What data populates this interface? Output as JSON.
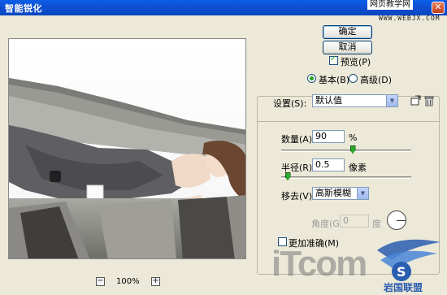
{
  "window": {
    "title": "智能锐化",
    "close_glyph": "✕"
  },
  "watermarks": {
    "site_name": "网页教学网",
    "site_url": "WWW.WEBJX.COM",
    "itcom_logo": "iTcom",
    "badge_text": "岩国联盟"
  },
  "buttons": {
    "ok": "确定",
    "cancel": "取消"
  },
  "preview_toggle": {
    "label": "预览(P)",
    "checked": true
  },
  "mode": {
    "basic": "基本(B)",
    "advanced": "高级(D)",
    "selected": "basic"
  },
  "settings": {
    "label": "设置(S):",
    "value": "默认值",
    "amount": {
      "label": "数量(A):",
      "value": "90",
      "unit": "%",
      "slider_level": 0.55
    },
    "radius": {
      "label": "半径(R):",
      "value": "0.5",
      "unit": "像素",
      "slider_level": 0.05
    },
    "remove": {
      "label": "移去(V):",
      "value": "高斯模糊"
    },
    "angle": {
      "label": "角度(G):",
      "value": "0",
      "unit": "度",
      "enabled": false
    },
    "more_accurate": {
      "label": "更加准确(M)",
      "checked": false
    }
  },
  "zoom": {
    "level": "100%",
    "minus": "−",
    "plus": "+"
  },
  "colors": {
    "titlebar": "#0a5fe8",
    "dialog_bg": "#ece9d8",
    "accent_green": "#21a121"
  }
}
